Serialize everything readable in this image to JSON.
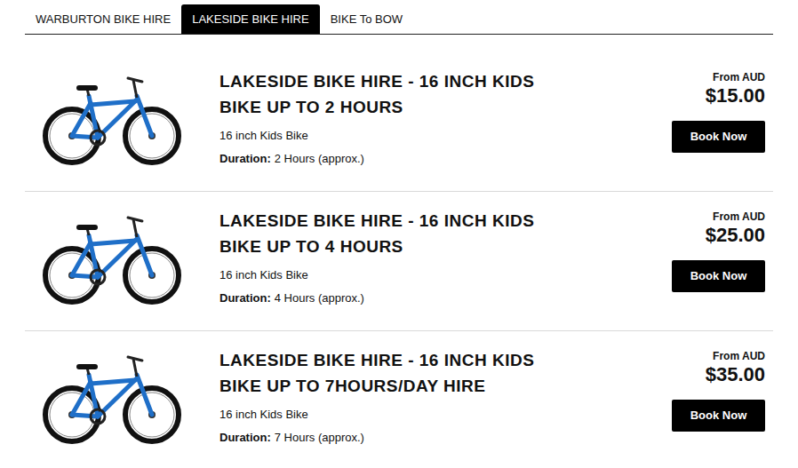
{
  "tabs": [
    {
      "label": "WARBURTON BIKE HIRE",
      "selected": false
    },
    {
      "label": "LAKESIDE BIKE HIRE",
      "selected": true
    },
    {
      "label": "BIKE To BOW",
      "selected": false
    }
  ],
  "products": [
    {
      "title": "LAKESIDE BIKE HIRE - 16 INCH KIDS BIKE UP TO 2 HOURS",
      "description": "16 inch Kids Bike",
      "duration_label": "Duration:",
      "duration": "2 Hours (approx.)",
      "price_prefix": "From AUD",
      "price": "$15.00",
      "button": "Book Now"
    },
    {
      "title": "LAKESIDE BIKE HIRE - 16 INCH KIDS BIKE UP TO 4 HOURS",
      "description": "16 inch Kids Bike",
      "duration_label": "Duration:",
      "duration": "4 Hours (approx.)",
      "price_prefix": "From AUD",
      "price": "$25.00",
      "button": "Book Now"
    },
    {
      "title": "LAKESIDE BIKE HIRE - 16 INCH KIDS BIKE UP TO 7HOURS/DAY HIRE",
      "description": "16 inch Kids Bike",
      "duration_label": "Duration:",
      "duration": "7 Hours (approx.)",
      "price_prefix": "From AUD",
      "price": "$35.00",
      "button": "Book Now"
    }
  ]
}
